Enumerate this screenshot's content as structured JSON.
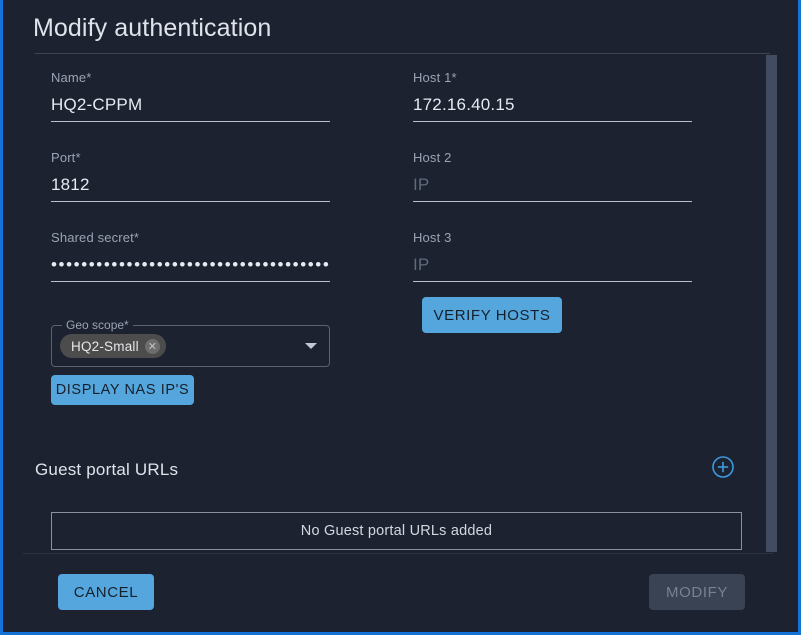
{
  "dialog": {
    "title": "Modify authentication"
  },
  "form": {
    "name": {
      "label": "Name*",
      "value": "HQ2-CPPM"
    },
    "port": {
      "label": "Port*",
      "value": "1812"
    },
    "shared_secret": {
      "label": "Shared secret*",
      "value": "••••••••••••••••••••••••••••••••••••••••••••••••••••"
    },
    "geo_scope": {
      "label": "Geo scope*",
      "chip": "HQ2-Small",
      "chip_remove_icon": "✕",
      "arrow_icon": "chevron-down-icon"
    },
    "host1": {
      "label": "Host 1*",
      "value": "172.16.40.15",
      "placeholder": "IP"
    },
    "host2": {
      "label": "Host 2",
      "value": "",
      "placeholder": "IP"
    },
    "host3": {
      "label": "Host 3",
      "value": "",
      "placeholder": "IP"
    }
  },
  "buttons": {
    "display_nas": "DISPLAY NAS IP'S",
    "verify_hosts": "VERIFY HOSTS",
    "cancel": "CANCEL",
    "modify": "MODIFY"
  },
  "guest_portal": {
    "title": "Guest portal URLs",
    "add_icon": "plus-circle-icon",
    "empty_message": "No Guest portal URLs added"
  },
  "colors": {
    "accent_blue": "#55a6dd",
    "border_blue": "#1573d8",
    "background": "#1c2230",
    "disabled_button": "#3a4354"
  }
}
